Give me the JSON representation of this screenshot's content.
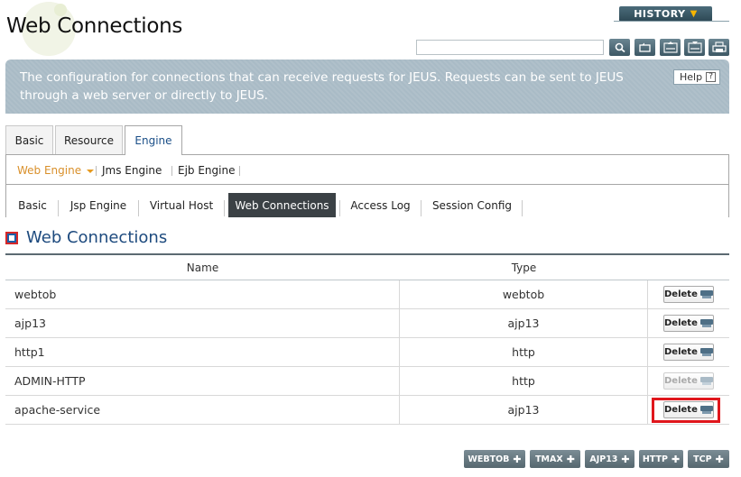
{
  "header": {
    "title": "Web Connections",
    "history_label": "HISTORY",
    "search": {
      "value": "",
      "placeholder": ""
    },
    "tools": [
      "search-icon",
      "reload-icon",
      "xml-export-icon",
      "xml-import-icon",
      "print-icon"
    ]
  },
  "description": {
    "text": "The configuration for connections that can receive requests for JEUS. Requests can be sent to JEUS through a web server or directly to JEUS.",
    "help_label": "Help"
  },
  "main_tabs": [
    {
      "label": "Basic"
    },
    {
      "label": "Resource"
    },
    {
      "label": "Engine",
      "active": true
    }
  ],
  "sub_nav": [
    {
      "label": "Web Engine",
      "active": true
    },
    {
      "label": "Jms Engine"
    },
    {
      "label": "Ejb Engine"
    }
  ],
  "section_tabs": [
    {
      "label": "Basic"
    },
    {
      "label": "Jsp Engine"
    },
    {
      "label": "Virtual Host"
    },
    {
      "label": "Web Connections",
      "active": true
    },
    {
      "label": "Access Log"
    },
    {
      "label": "Session Config"
    }
  ],
  "section": {
    "title": "Web Connections"
  },
  "table": {
    "columns": [
      "Name",
      "Type"
    ],
    "rows": [
      {
        "name": "webtob",
        "type": "webtob",
        "action": "Delete",
        "enabled": true
      },
      {
        "name": "ajp13",
        "type": "ajp13",
        "action": "Delete",
        "enabled": true
      },
      {
        "name": "http1",
        "type": "http",
        "action": "Delete",
        "enabled": true
      },
      {
        "name": "ADMIN-HTTP",
        "type": "http",
        "action": "Delete",
        "enabled": false
      },
      {
        "name": "apache-service",
        "type": "ajp13",
        "action": "Delete",
        "enabled": true,
        "highlighted": true
      }
    ]
  },
  "add_buttons": [
    {
      "label": "WEBTOB"
    },
    {
      "label": "TMAX"
    },
    {
      "label": "AJP13"
    },
    {
      "label": "HTTP"
    },
    {
      "label": "TCP"
    }
  ],
  "colors": {
    "banner": "#a9bbc6",
    "section_title": "#1d4a7e",
    "active_tab": "#3b4145",
    "subnav_active": "#d9902b",
    "highlight": "#e0161c"
  }
}
